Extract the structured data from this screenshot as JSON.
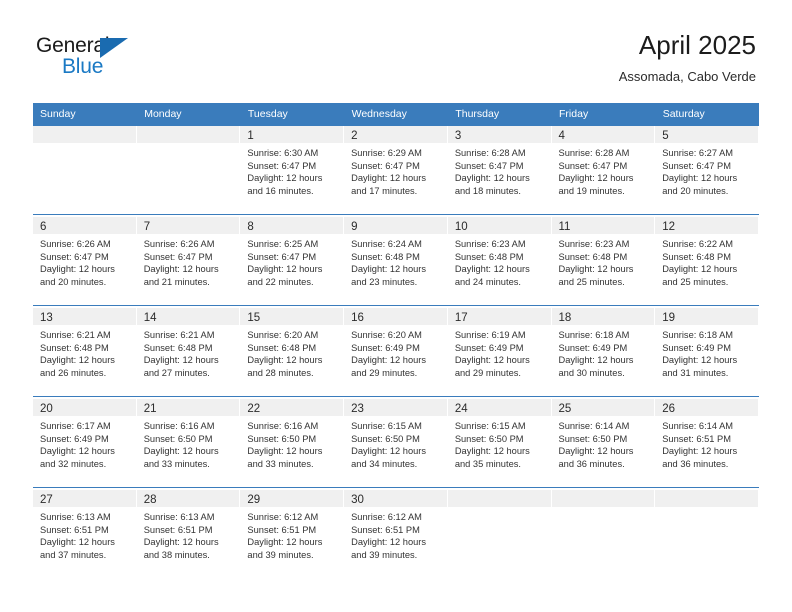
{
  "brand": {
    "name_top": "General",
    "name_bottom": "Blue",
    "top_color": "#1a1a1a",
    "bottom_color": "#1a79c4",
    "triangle_color": "#1a6bb0"
  },
  "header": {
    "title": "April 2025",
    "subtitle": "Assomada, Cabo Verde"
  },
  "theme": {
    "header_blue": "#3a7cbc",
    "daynum_band": "#f0f0f0",
    "text": "#333333"
  },
  "weekdays": [
    "Sunday",
    "Monday",
    "Tuesday",
    "Wednesday",
    "Thursday",
    "Friday",
    "Saturday"
  ],
  "weeks": [
    [
      {
        "day": "",
        "lines": []
      },
      {
        "day": "",
        "lines": []
      },
      {
        "day": "1",
        "lines": [
          "Sunrise: 6:30 AM",
          "Sunset: 6:47 PM",
          "Daylight: 12 hours",
          "and 16 minutes."
        ]
      },
      {
        "day": "2",
        "lines": [
          "Sunrise: 6:29 AM",
          "Sunset: 6:47 PM",
          "Daylight: 12 hours",
          "and 17 minutes."
        ]
      },
      {
        "day": "3",
        "lines": [
          "Sunrise: 6:28 AM",
          "Sunset: 6:47 PM",
          "Daylight: 12 hours",
          "and 18 minutes."
        ]
      },
      {
        "day": "4",
        "lines": [
          "Sunrise: 6:28 AM",
          "Sunset: 6:47 PM",
          "Daylight: 12 hours",
          "and 19 minutes."
        ]
      },
      {
        "day": "5",
        "lines": [
          "Sunrise: 6:27 AM",
          "Sunset: 6:47 PM",
          "Daylight: 12 hours",
          "and 20 minutes."
        ]
      }
    ],
    [
      {
        "day": "6",
        "lines": [
          "Sunrise: 6:26 AM",
          "Sunset: 6:47 PM",
          "Daylight: 12 hours",
          "and 20 minutes."
        ]
      },
      {
        "day": "7",
        "lines": [
          "Sunrise: 6:26 AM",
          "Sunset: 6:47 PM",
          "Daylight: 12 hours",
          "and 21 minutes."
        ]
      },
      {
        "day": "8",
        "lines": [
          "Sunrise: 6:25 AM",
          "Sunset: 6:47 PM",
          "Daylight: 12 hours",
          "and 22 minutes."
        ]
      },
      {
        "day": "9",
        "lines": [
          "Sunrise: 6:24 AM",
          "Sunset: 6:48 PM",
          "Daylight: 12 hours",
          "and 23 minutes."
        ]
      },
      {
        "day": "10",
        "lines": [
          "Sunrise: 6:23 AM",
          "Sunset: 6:48 PM",
          "Daylight: 12 hours",
          "and 24 minutes."
        ]
      },
      {
        "day": "11",
        "lines": [
          "Sunrise: 6:23 AM",
          "Sunset: 6:48 PM",
          "Daylight: 12 hours",
          "and 25 minutes."
        ]
      },
      {
        "day": "12",
        "lines": [
          "Sunrise: 6:22 AM",
          "Sunset: 6:48 PM",
          "Daylight: 12 hours",
          "and 25 minutes."
        ]
      }
    ],
    [
      {
        "day": "13",
        "lines": [
          "Sunrise: 6:21 AM",
          "Sunset: 6:48 PM",
          "Daylight: 12 hours",
          "and 26 minutes."
        ]
      },
      {
        "day": "14",
        "lines": [
          "Sunrise: 6:21 AM",
          "Sunset: 6:48 PM",
          "Daylight: 12 hours",
          "and 27 minutes."
        ]
      },
      {
        "day": "15",
        "lines": [
          "Sunrise: 6:20 AM",
          "Sunset: 6:48 PM",
          "Daylight: 12 hours",
          "and 28 minutes."
        ]
      },
      {
        "day": "16",
        "lines": [
          "Sunrise: 6:20 AM",
          "Sunset: 6:49 PM",
          "Daylight: 12 hours",
          "and 29 minutes."
        ]
      },
      {
        "day": "17",
        "lines": [
          "Sunrise: 6:19 AM",
          "Sunset: 6:49 PM",
          "Daylight: 12 hours",
          "and 29 minutes."
        ]
      },
      {
        "day": "18",
        "lines": [
          "Sunrise: 6:18 AM",
          "Sunset: 6:49 PM",
          "Daylight: 12 hours",
          "and 30 minutes."
        ]
      },
      {
        "day": "19",
        "lines": [
          "Sunrise: 6:18 AM",
          "Sunset: 6:49 PM",
          "Daylight: 12 hours",
          "and 31 minutes."
        ]
      }
    ],
    [
      {
        "day": "20",
        "lines": [
          "Sunrise: 6:17 AM",
          "Sunset: 6:49 PM",
          "Daylight: 12 hours",
          "and 32 minutes."
        ]
      },
      {
        "day": "21",
        "lines": [
          "Sunrise: 6:16 AM",
          "Sunset: 6:50 PM",
          "Daylight: 12 hours",
          "and 33 minutes."
        ]
      },
      {
        "day": "22",
        "lines": [
          "Sunrise: 6:16 AM",
          "Sunset: 6:50 PM",
          "Daylight: 12 hours",
          "and 33 minutes."
        ]
      },
      {
        "day": "23",
        "lines": [
          "Sunrise: 6:15 AM",
          "Sunset: 6:50 PM",
          "Daylight: 12 hours",
          "and 34 minutes."
        ]
      },
      {
        "day": "24",
        "lines": [
          "Sunrise: 6:15 AM",
          "Sunset: 6:50 PM",
          "Daylight: 12 hours",
          "and 35 minutes."
        ]
      },
      {
        "day": "25",
        "lines": [
          "Sunrise: 6:14 AM",
          "Sunset: 6:50 PM",
          "Daylight: 12 hours",
          "and 36 minutes."
        ]
      },
      {
        "day": "26",
        "lines": [
          "Sunrise: 6:14 AM",
          "Sunset: 6:51 PM",
          "Daylight: 12 hours",
          "and 36 minutes."
        ]
      }
    ],
    [
      {
        "day": "27",
        "lines": [
          "Sunrise: 6:13 AM",
          "Sunset: 6:51 PM",
          "Daylight: 12 hours",
          "and 37 minutes."
        ]
      },
      {
        "day": "28",
        "lines": [
          "Sunrise: 6:13 AM",
          "Sunset: 6:51 PM",
          "Daylight: 12 hours",
          "and 38 minutes."
        ]
      },
      {
        "day": "29",
        "lines": [
          "Sunrise: 6:12 AM",
          "Sunset: 6:51 PM",
          "Daylight: 12 hours",
          "and 39 minutes."
        ]
      },
      {
        "day": "30",
        "lines": [
          "Sunrise: 6:12 AM",
          "Sunset: 6:51 PM",
          "Daylight: 12 hours",
          "and 39 minutes."
        ]
      },
      {
        "day": "",
        "lines": []
      },
      {
        "day": "",
        "lines": []
      },
      {
        "day": "",
        "lines": []
      }
    ]
  ]
}
